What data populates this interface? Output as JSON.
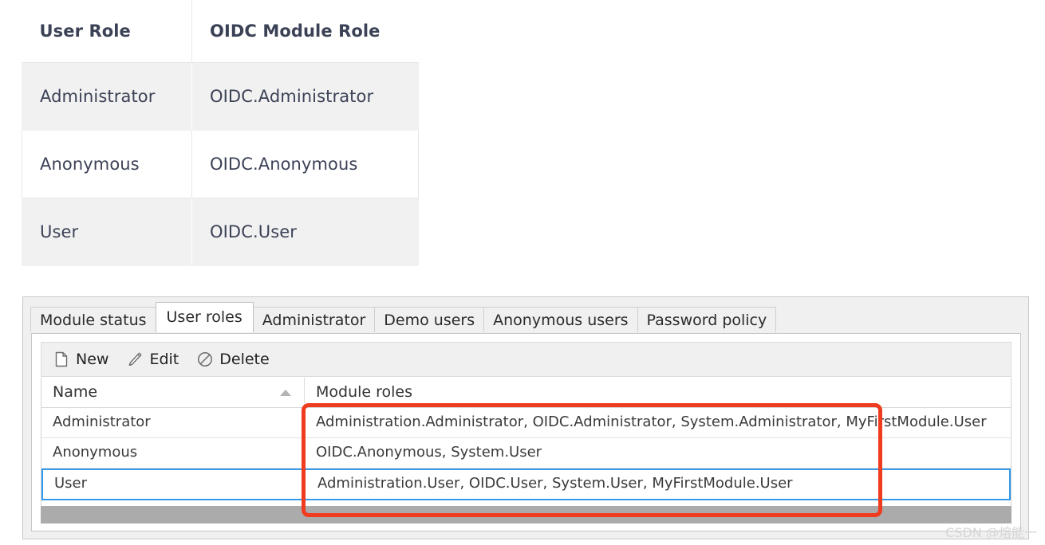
{
  "doc_table": {
    "headers": [
      "User Role",
      "OIDC Module Role"
    ],
    "rows": [
      {
        "user_role": "Administrator",
        "module_role": "OIDC.Administrator"
      },
      {
        "user_role": "Anonymous",
        "module_role": "OIDC.Anonymous"
      },
      {
        "user_role": "User",
        "module_role": "OIDC.User"
      }
    ]
  },
  "app": {
    "tabs": [
      {
        "label": "Module status",
        "active": false
      },
      {
        "label": "User roles",
        "active": true
      },
      {
        "label": "Administrator",
        "active": false
      },
      {
        "label": "Demo users",
        "active": false
      },
      {
        "label": "Anonymous users",
        "active": false
      },
      {
        "label": "Password policy",
        "active": false
      }
    ],
    "toolbar": {
      "new_label": "New",
      "edit_label": "Edit",
      "delete_label": "Delete",
      "new_icon": "document-icon",
      "edit_icon": "pencil-icon",
      "delete_icon": "no-entry-icon"
    },
    "grid": {
      "columns": [
        "Name",
        "Module roles"
      ],
      "sort_column": "Name",
      "sort_direction": "ascending",
      "sort_icon": "caret-up-icon",
      "rows": [
        {
          "name": "Administrator",
          "module_roles": "Administration.Administrator, OIDC.Administrator, System.Administrator, MyFirstModule.User",
          "selected": false
        },
        {
          "name": "Anonymous",
          "module_roles": "OIDC.Anonymous, System.User",
          "selected": false
        },
        {
          "name": "User",
          "module_roles": "Administration.User, OIDC.User, System.User, MyFirstModule.User",
          "selected": true
        }
      ]
    }
  },
  "annotation": {
    "highlight_color": "#ef3b1e",
    "selection_color": "#3399e8"
  },
  "watermark": {
    "text": "CSDN @熔能一"
  }
}
